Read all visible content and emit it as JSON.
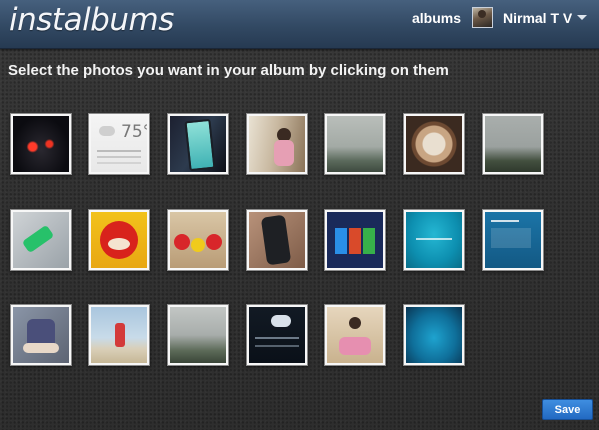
{
  "header": {
    "logo": "instalbums",
    "nav_albums": "albums",
    "user_name": "Nirmal T V"
  },
  "instructions": "Select the photos you want in your album by clicking on them",
  "weather_thumb_temp": "75°",
  "save_label": "Save",
  "photos": [
    {
      "name": "photo-car-dashboard"
    },
    {
      "name": "photo-weather-widget"
    },
    {
      "name": "photo-phone-hand"
    },
    {
      "name": "photo-child-window"
    },
    {
      "name": "photo-misty-trees"
    },
    {
      "name": "photo-coffee-cup"
    },
    {
      "name": "photo-foggy-palms"
    },
    {
      "name": "photo-green-gadget"
    },
    {
      "name": "photo-angry-bird-red"
    },
    {
      "name": "photo-angry-birds-toys"
    },
    {
      "name": "photo-remote-hand"
    },
    {
      "name": "photo-windows8-start"
    },
    {
      "name": "photo-windows8-setup"
    },
    {
      "name": "photo-windows8-os"
    },
    {
      "name": "photo-child-bicycle"
    },
    {
      "name": "photo-beach-person"
    },
    {
      "name": "photo-trees-overcast"
    },
    {
      "name": "photo-weather-app"
    },
    {
      "name": "photo-child-toy-car"
    },
    {
      "name": "photo-blue-screen"
    }
  ]
}
